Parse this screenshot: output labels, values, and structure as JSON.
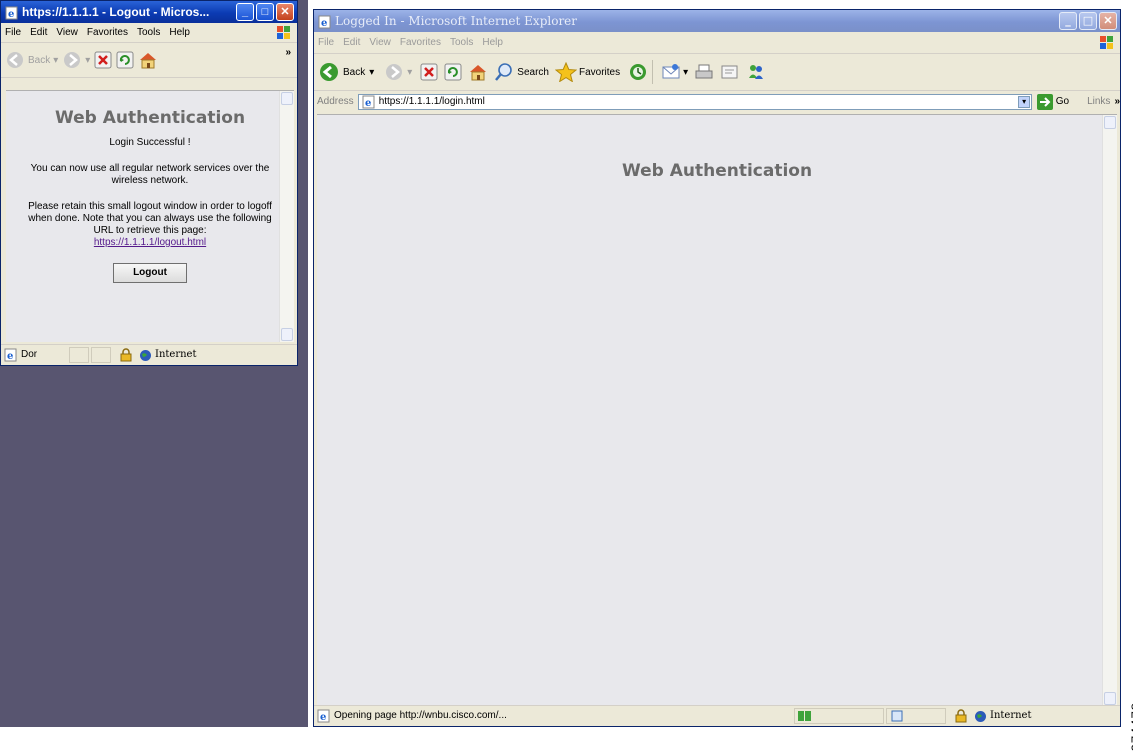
{
  "logout_window": {
    "title": "https://1.1.1.1 - Logout - Micros...",
    "menu": [
      "File",
      "Edit",
      "View",
      "Favorites",
      "Tools",
      "Help"
    ],
    "toolbar": {
      "back_label": "Back",
      "chevron": "»"
    },
    "heading": "Web Authentication",
    "success_text": "Login Successful !",
    "message_1": "You can now use all regular network services over the wireless network.",
    "message_2": "Please retain this small logout window in order to logoff when done. Note that you can always use the following URL to retrieve this page:",
    "logout_url": "https://1.1.1.1/logout.html",
    "logout_button": "Logout",
    "status": {
      "text": "Dor",
      "zone": "Internet"
    }
  },
  "main_window": {
    "title": "Logged In - Microsoft Internet Explorer",
    "menu": [
      "File",
      "Edit",
      "View",
      "Favorites",
      "Tools",
      "Help"
    ],
    "toolbar": {
      "back_label": "Back",
      "search_label": "Search",
      "favorites_label": "Favorites"
    },
    "address": {
      "label": "Address",
      "value": "https://1.1.1.1/login.html",
      "go_label": "Go",
      "links_label": "Links",
      "links_chevron": "»"
    },
    "heading": "Web Authentication",
    "status": {
      "text": "Opening page http://wnbu.cisco.com/...",
      "zone": "Internet"
    }
  },
  "figure_id": "274478",
  "colors": {
    "desktop": "#585570",
    "titlebar_active": "#0b3bb3",
    "titlebar_inactive": "#7d95d3",
    "content_bg": "#e8e8ec",
    "heading": "#6b6b6b"
  },
  "icons": [
    "ie-page-icon",
    "minimize-icon",
    "maximize-icon",
    "close-icon",
    "windows-flag-icon",
    "back-icon",
    "forward-icon",
    "stop-icon",
    "refresh-icon",
    "home-icon",
    "search-icon",
    "favorites-icon",
    "history-icon",
    "mail-icon",
    "print-icon",
    "edit-icon",
    "messenger-icon",
    "go-icon",
    "lock-icon",
    "globe-icon"
  ]
}
